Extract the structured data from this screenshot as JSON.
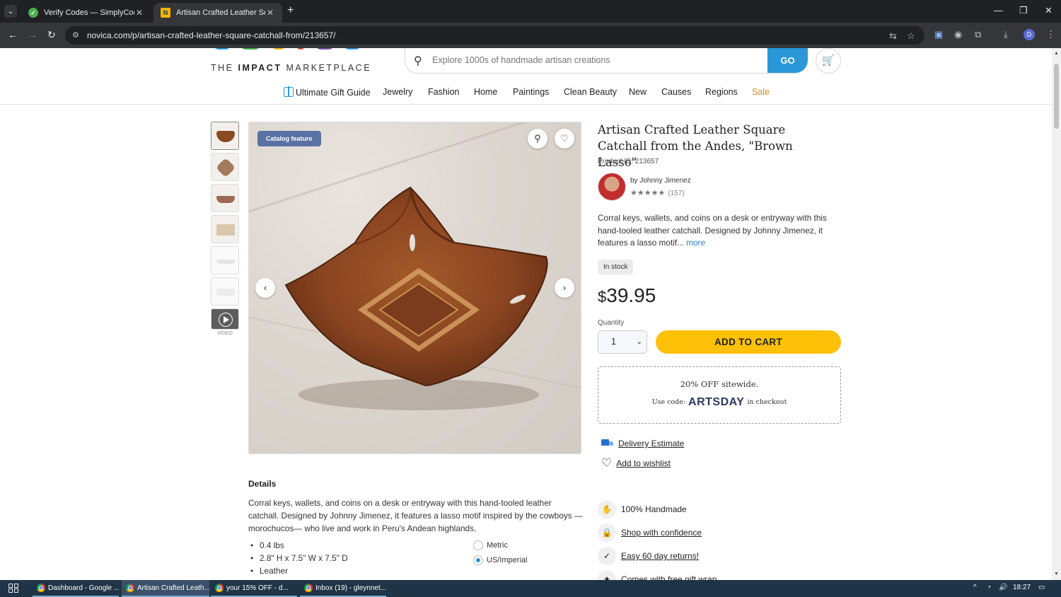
{
  "browser": {
    "tabs": [
      {
        "title": "Verify Codes — SimplyCodes",
        "active": false
      },
      {
        "title": "Artisan Crafted Leather Square",
        "active": true
      }
    ],
    "url": "novica.com/p/artisan-crafted-leather-square-catchall-from/213657/",
    "profile_initial": "D"
  },
  "header": {
    "logo_tag_pre": "THE",
    "logo_tag_bold": "IMPACT",
    "logo_tag_post": "MARKETPLACE",
    "search_placeholder": "Explore 1000s of handmade artisan creations",
    "go_label": "GO"
  },
  "nav": {
    "items": [
      "Ultimate Gift Guide",
      "Jewelry",
      "Fashion",
      "Home",
      "Paintings",
      "Clean Beauty",
      "New",
      "Causes",
      "Regions",
      "Sale"
    ],
    "sale_color": "#d4892a"
  },
  "gallery": {
    "badge": "Catalog feature",
    "video_label": "VIDEO"
  },
  "product": {
    "title": "Artisan Crafted Leather Square Catchall from the Andes, \"Brown Lasso\"",
    "product_id": "Product ID: 213657",
    "by_prefix": "by",
    "artisan": "Johnny Jimenez",
    "stars": "★★★★★",
    "rating_stars": 5,
    "review_count": "(157)",
    "short_desc": "Corral keys, wallets, and coins on a desk or entryway with this hand-tooled leather catchall. Designed by Johnny Jimenez, it features a lasso motif...",
    "more_label": "more",
    "stock": "In stock",
    "price_currency": "$",
    "price_value": "39.95",
    "quantity_label": "Quantity",
    "quantity_value": "1",
    "add_to_cart": "ADD TO CART"
  },
  "promo": {
    "line1": "20% OFF sitewide.",
    "use_code": "Use code:",
    "code": "ARTSDAY",
    "in_checkout": "in checkout"
  },
  "links": {
    "delivery": "Delivery Estimate",
    "wishlist": "Add to wishlist"
  },
  "features": [
    {
      "icon": "hand-icon",
      "label": "100% Handmade",
      "link": false
    },
    {
      "icon": "lock-icon",
      "label": "Shop with confidence",
      "link": true
    },
    {
      "icon": "check-icon",
      "label": "Easy 60 day returns!",
      "link": true
    },
    {
      "icon": "gift-icon",
      "label": "Comes with free gift wrap",
      "link": false
    }
  ],
  "details": {
    "heading": "Details",
    "paragraph": "Corral keys, wallets, and coins on a desk or entryway with this hand-tooled leather catchall. Designed by Johnny Jimenez, it features a lasso motif inspired by the cowboys — morochucos— who live and work in Peru's Andean highlands.",
    "specs": [
      "0.4 lbs",
      "2.8\" H x 7.5\" W x 7.5\" D",
      "Leather"
    ],
    "units": [
      {
        "label": "Metric",
        "selected": false
      },
      {
        "label": "US/Imperial",
        "selected": true
      }
    ]
  },
  "taskbar": {
    "apps": [
      "Dashboard - Google ...",
      "Artisan Crafted Leath...",
      "your 15% OFF - d...",
      "Inbox (19) - gleynnet..."
    ],
    "time": "18:27"
  },
  "colors": {
    "accent_blue": "#2a98d8",
    "cart_yellow": "#ffc107",
    "badge_blue": "#5872a4"
  }
}
